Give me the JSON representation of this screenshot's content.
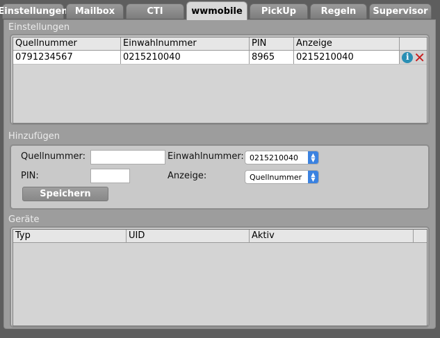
{
  "tabs": [
    {
      "label": "Einstellungen"
    },
    {
      "label": "Mailbox"
    },
    {
      "label": "CTI"
    },
    {
      "label": "wwmobile"
    },
    {
      "label": "PickUp"
    },
    {
      "label": "Regeln"
    },
    {
      "label": "Supervisor"
    }
  ],
  "active_tab": "wwmobile",
  "settings": {
    "title": "Einstellungen",
    "columns": [
      "Quellnummer",
      "Einwahlnummer",
      "PIN",
      "Anzeige"
    ],
    "rows": [
      {
        "quellnummer": "0791234567",
        "einwahlnummer": "0215210040",
        "pin": "8965",
        "anzeige": "0215210040"
      }
    ],
    "row_actions": [
      "info-icon",
      "close-icon"
    ]
  },
  "add": {
    "title": "Hinzufügen",
    "quellnummer_label": "Quellnummer:",
    "quellnummer_value": "",
    "pin_label": "PIN:",
    "pin_value": "",
    "einwahlnummer_label": "Einwahlnummer:",
    "einwahlnummer_selected": "0215210040",
    "anzeige_label": "Anzeige:",
    "anzeige_selected": "Quellnummer",
    "save_label": "Speichern"
  },
  "devices": {
    "title": "Geräte",
    "columns": [
      "Typ",
      "UID",
      "Aktiv"
    ],
    "rows": []
  },
  "colors": {
    "background": "#5e5e5e",
    "panel": "#9d9d9d",
    "accent_select": "#3b82e0",
    "info": "#2a8fb4",
    "delete": "#c81f1f"
  }
}
